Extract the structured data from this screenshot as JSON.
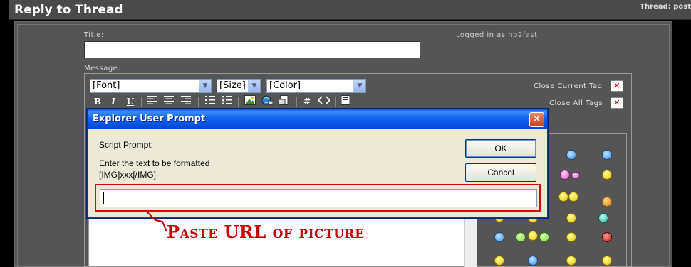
{
  "header": {
    "title": "Reply to Thread",
    "thread_meta": "Thread: post"
  },
  "form": {
    "title_label": "Title:",
    "logged_in_prefix": "Logged in as",
    "username": "np2fast",
    "message_label": "Message:"
  },
  "editor": {
    "font_select": "[Font]",
    "size_select": "[Size]",
    "color_select": "[Color]",
    "bold": "B",
    "italic": "I",
    "underline": "U",
    "close_current_tag": "Close Current Tag",
    "close_all_tags": "Close All Tags",
    "close_symbol": "✕"
  },
  "dialog": {
    "title": "Explorer User Prompt",
    "close_symbol": "✕",
    "script_prompt": "Script Prompt:",
    "message_line1": "Enter the text to be formatted",
    "message_line2": "[IMG]xxx[/IMG]",
    "ok_label": "OK",
    "cancel_label": "Cancel",
    "input_value": ""
  },
  "annotation": {
    "text": "Paste URL of picture",
    "color": "#c40000"
  },
  "colors": {
    "panel_bg": "#555555",
    "dialog_bg": "#ece9d8",
    "titlebar_blue": "#0046d5"
  }
}
